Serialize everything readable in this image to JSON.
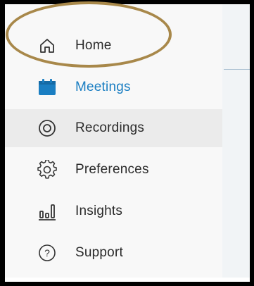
{
  "sidebar": {
    "items": [
      {
        "id": "home",
        "label": "Home",
        "icon": "home-icon",
        "active": false
      },
      {
        "id": "meetings",
        "label": "Meetings",
        "icon": "calendar-icon",
        "active": false
      },
      {
        "id": "recordings",
        "label": "Recordings",
        "icon": "record-icon",
        "active": true
      },
      {
        "id": "preferences",
        "label": "Preferences",
        "icon": "gear-icon",
        "active": false
      },
      {
        "id": "insights",
        "label": "Insights",
        "icon": "bar-chart-icon",
        "active": false
      },
      {
        "id": "support",
        "label": "Support",
        "icon": "help-icon",
        "active": false
      }
    ]
  },
  "colors": {
    "accent": "#1a7ec2",
    "text": "#2a2a2a",
    "highlight_ring": "#a8884a",
    "active_row": "#ebebeb"
  }
}
